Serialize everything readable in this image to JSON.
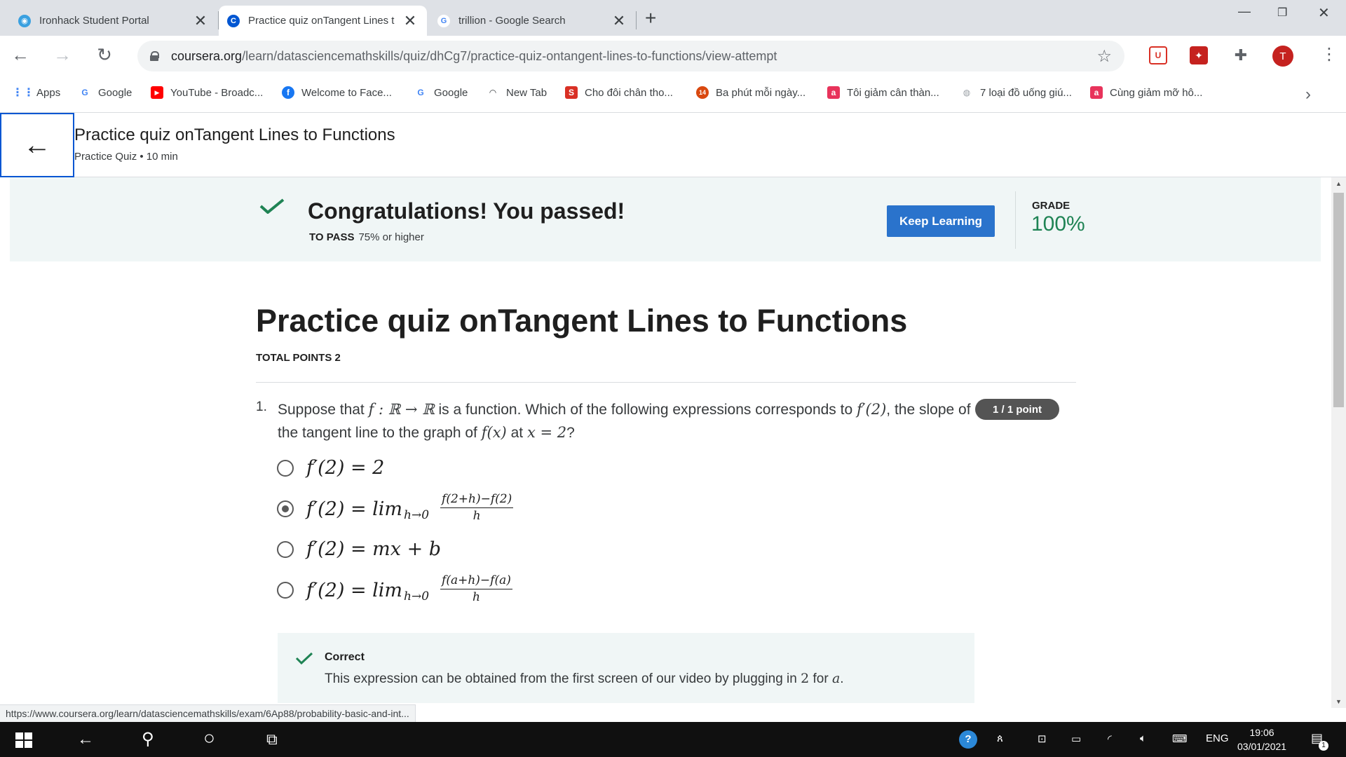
{
  "browser": {
    "tabs": [
      {
        "title": "Ironhack Student Portal",
        "active": false
      },
      {
        "title": "Practice quiz onTangent Lines t",
        "active": true
      },
      {
        "title": "trillion - Google Search",
        "active": false
      }
    ],
    "url_host": "coursera.org",
    "url_path": "/learn/datasciencemathskills/quiz/dhCg7/practice-quiz-ontangent-lines-to-functions/view-attempt",
    "profile_initial": "T",
    "bookmarks": [
      {
        "label": "Apps",
        "icon": "apps-grid-icon"
      },
      {
        "label": "Google",
        "icon": "google-icon"
      },
      {
        "label": "YouTube - Broadc...",
        "icon": "youtube-icon"
      },
      {
        "label": "Welcome to Face...",
        "icon": "facebook-icon"
      },
      {
        "label": "Google",
        "icon": "google-icon"
      },
      {
        "label": "New Tab",
        "icon": "new-tab-icon"
      },
      {
        "label": "Cho đôi chân tho...",
        "icon": "s-site-icon"
      },
      {
        "label": "Ba phút mỗi ngày...",
        "icon": "site-14-icon"
      },
      {
        "label": "Tôi giảm cân thàn...",
        "icon": "a-site-icon"
      },
      {
        "label": "7 loại đồ uống giú...",
        "icon": "globe-icon"
      },
      {
        "label": "Cùng giảm mỡ hô...",
        "icon": "a-site-icon"
      }
    ],
    "status_url": "https://www.coursera.org/learn/datasciencemathskills/exam/6Ap88/probability-basic-and-int..."
  },
  "header": {
    "title": "Practice quiz onTangent Lines to Functions",
    "subtitle": "Practice Quiz • 10 min"
  },
  "banner": {
    "message": "Congratulations! You passed!",
    "to_pass_label": "TO PASS",
    "to_pass_value": "75% or higher",
    "button": "Keep Learning",
    "grade_label": "GRADE",
    "grade_value": "100%"
  },
  "quiz": {
    "title": "Practice quiz onTangent Lines to Functions",
    "total_points": "TOTAL POINTS 2",
    "question": {
      "number": "1.",
      "text_1": "Suppose that",
      "math_1": "f : ℝ → ℝ",
      "text_2": "is a function. Which of the following expressions corresponds to",
      "math_2": "f′(2)",
      "text_3": ", the slope of the tangent line to the graph of",
      "math_3": "f(x)",
      "text_4": "at",
      "math_4": "x = 2",
      "text_5": "?",
      "points": "1 / 1 point"
    },
    "options": [
      {
        "lhs": "f′(2) = 2",
        "selected": false
      },
      {
        "lhs": "f′(2) = lim",
        "sub": "h→0",
        "num": "f(2+h)−f(2)",
        "den": "h",
        "selected": true
      },
      {
        "lhs": "f′(2) = mx + b",
        "selected": false
      },
      {
        "lhs": "f′(2) = lim",
        "sub": "h→0",
        "num": "f(a+h)−f(a)",
        "den": "h",
        "selected": false
      }
    ],
    "feedback": {
      "label": "Correct",
      "text_1": "This expression can be obtained from the first screen of our video by plugging in",
      "math_1": "2",
      "text_2": "for",
      "math_2": "a",
      "text_3": "."
    }
  },
  "taskbar": {
    "lang": "ENG",
    "time": "19:06",
    "date": "03/01/2021",
    "notification_count": "1"
  },
  "colors": {
    "accent_blue": "#2a73cc",
    "success_green": "#1f8354",
    "banner_bg": "#f0f6f6",
    "badge_gray": "#545454"
  }
}
